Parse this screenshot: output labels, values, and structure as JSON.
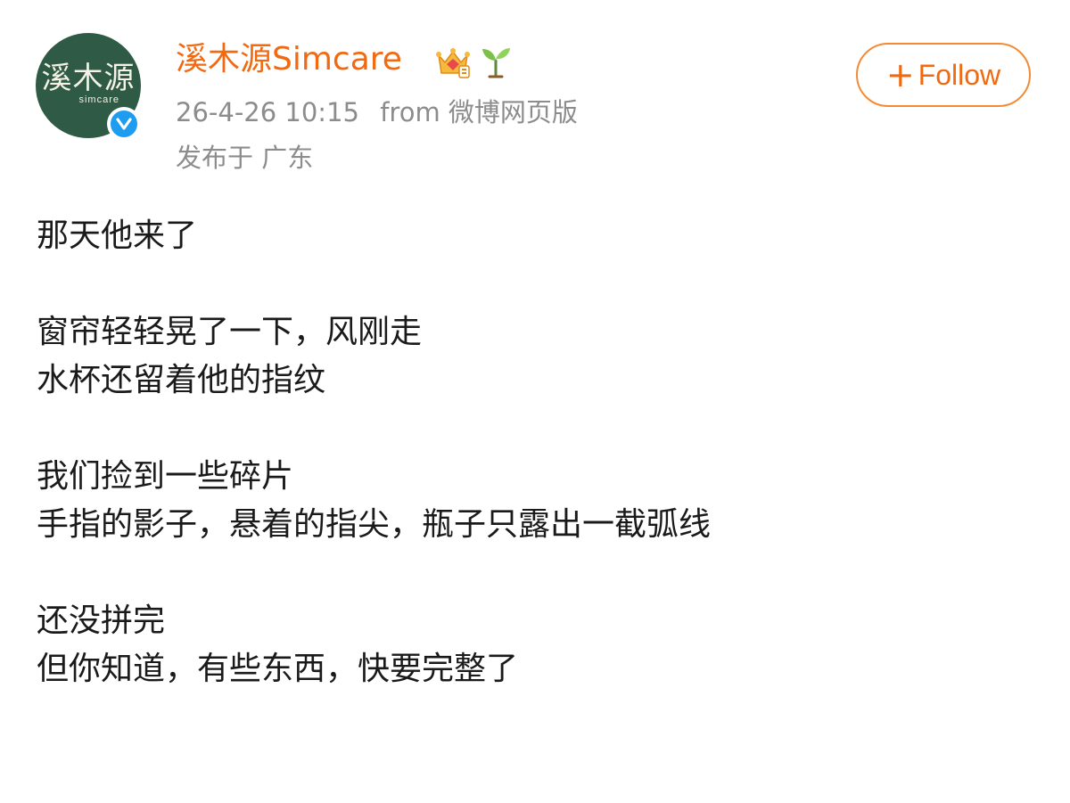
{
  "author": {
    "avatar_text": "溪木源",
    "avatar_subtext": "simcare",
    "name": "溪木源Simcare",
    "badges": [
      "crown-icon",
      "sprout-icon"
    ],
    "verified": true
  },
  "meta": {
    "timestamp": "26-4-26 10:15",
    "source": "from 微博网页版",
    "location": "发布于 广东"
  },
  "follow_button": {
    "icon": "+",
    "label": "Follow"
  },
  "post": {
    "paragraphs": [
      [
        "那天他来了"
      ],
      [
        "窗帘轻轻晃了一下，风刚走",
        "水杯还留着他的指纹"
      ],
      [
        "我们捡到一些碎片",
        "手指的影子，悬着的指尖，瓶子只露出一截弧线"
      ],
      [
        "还没拼完",
        "但你知道，有些东西，快要完整了"
      ]
    ]
  },
  "colors": {
    "accent": "#f06a12",
    "follow_border": "#f48a34",
    "meta": "#8c8c8c",
    "avatar_bg": "#2f5a45",
    "verified": "#1e9cf0"
  }
}
